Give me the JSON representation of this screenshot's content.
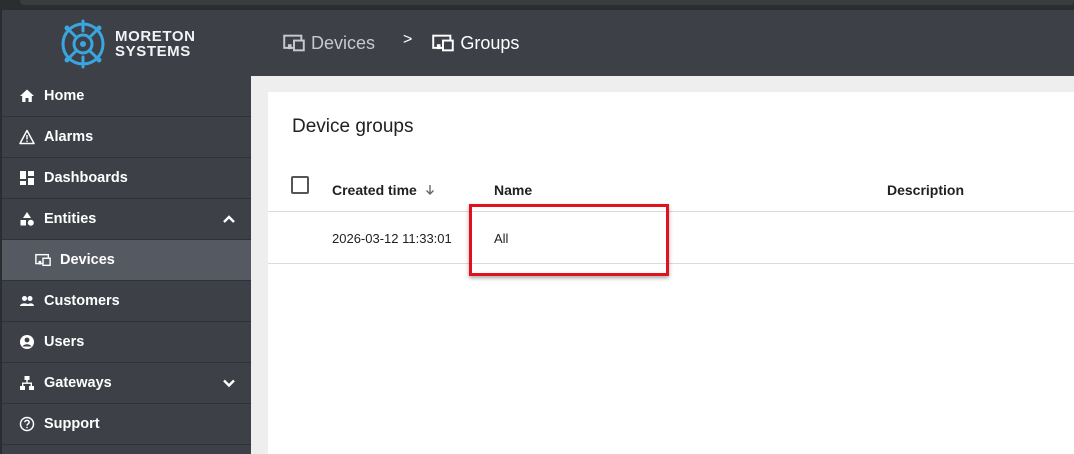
{
  "brand": {
    "line1": "MORETON",
    "line2": "SYSTEMS",
    "color": "#3aa6e0"
  },
  "nav": [
    {
      "label": "Home",
      "icon": "home-icon"
    },
    {
      "label": "Alarms",
      "icon": "warning-icon"
    },
    {
      "label": "Dashboards",
      "icon": "dashboard-icon"
    },
    {
      "label": "Entities",
      "icon": "shapes-icon",
      "expanded": true
    },
    {
      "label": "Devices",
      "icon": "devices-icon",
      "selected": true
    },
    {
      "label": "Customers",
      "icon": "people-icon"
    },
    {
      "label": "Users",
      "icon": "account-icon"
    },
    {
      "label": "Gateways",
      "icon": "hierarchy-icon",
      "expanded": false
    },
    {
      "label": "Support",
      "icon": "help-icon"
    }
  ],
  "breadcrumb": {
    "items": [
      "Devices",
      "Groups"
    ],
    "separator": ">"
  },
  "page": {
    "title": "Device groups",
    "columns": {
      "created": "Created time",
      "name": "Name",
      "description": "Description"
    },
    "rows": [
      {
        "created": "2026-03-12 11:33:01",
        "name": "All",
        "description": ""
      }
    ]
  },
  "colors": {
    "sidebar": "#3d4047",
    "highlight": "#e0121b",
    "selected": "#555962"
  }
}
